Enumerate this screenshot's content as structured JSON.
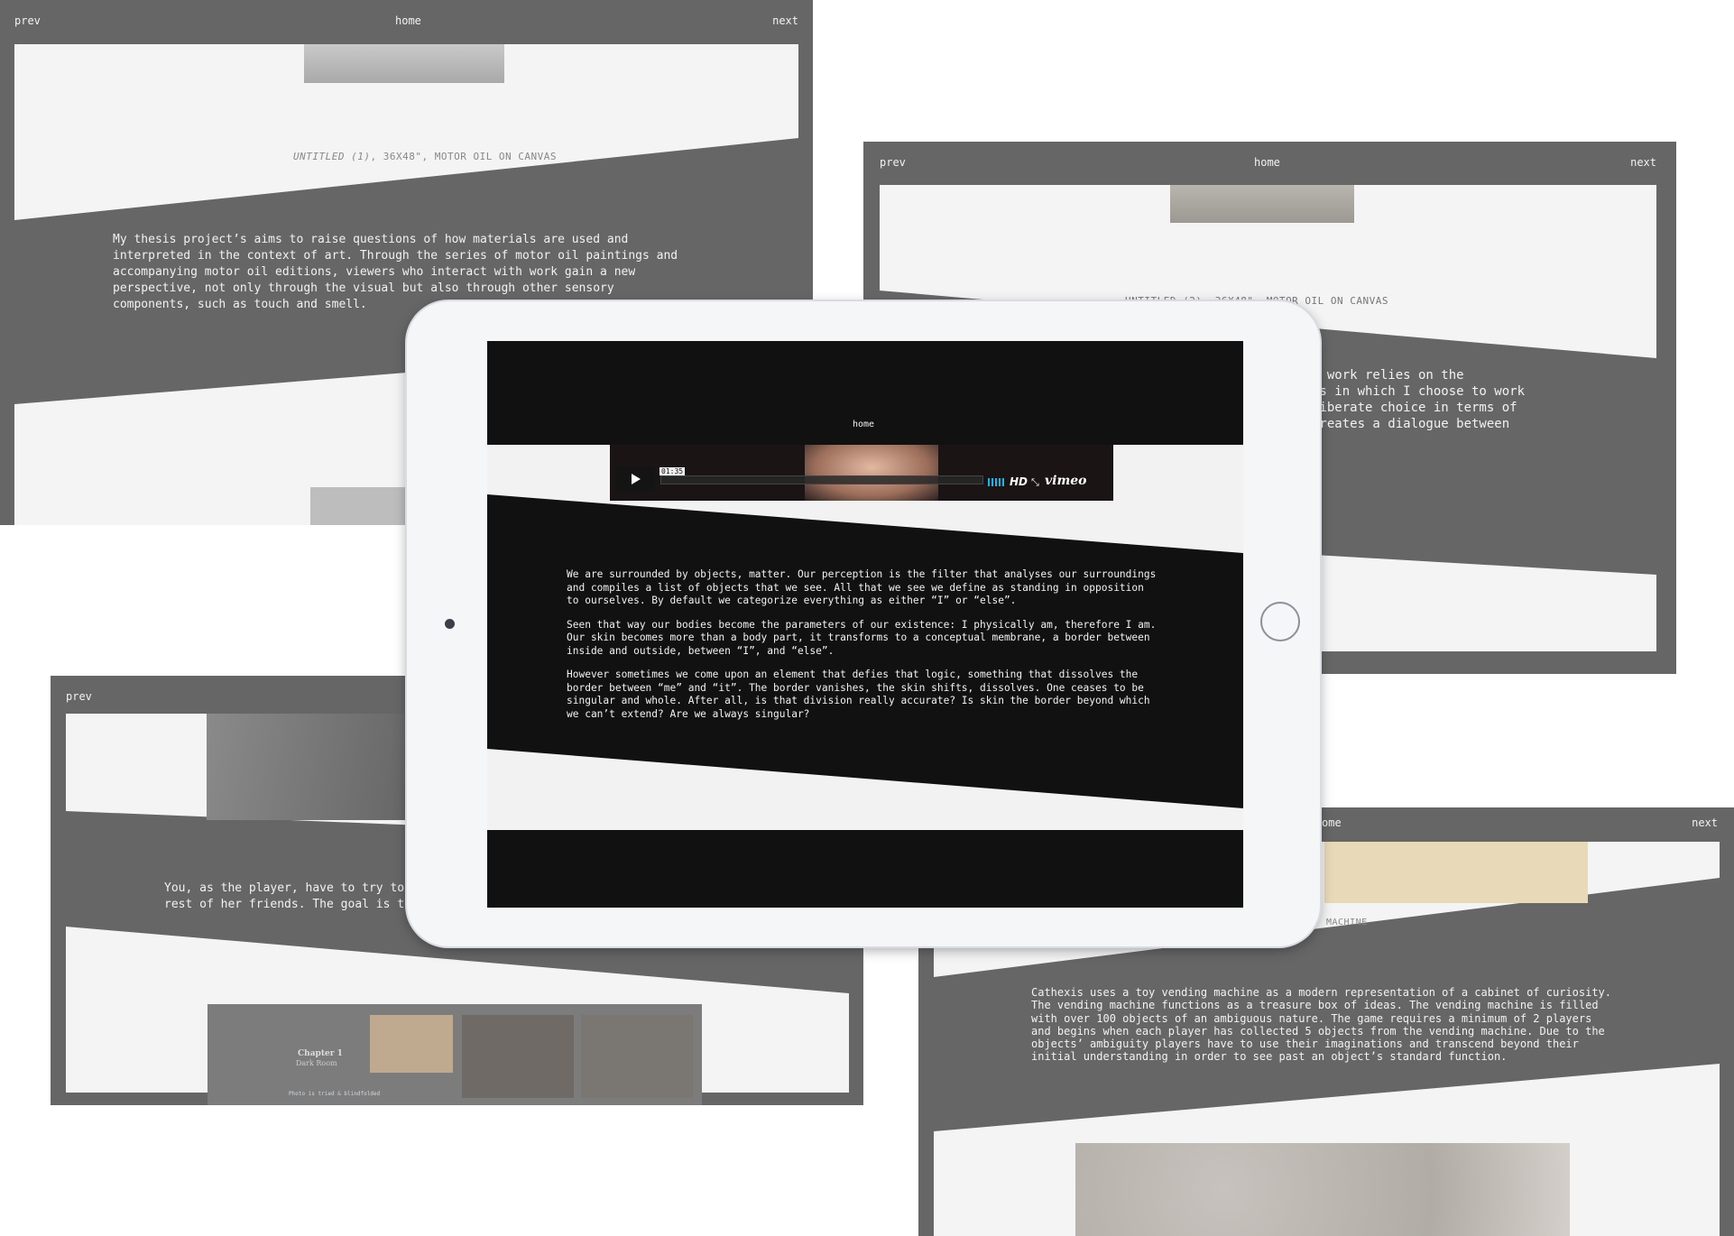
{
  "nav": {
    "prev": "prev",
    "home": "home",
    "next": "next"
  },
  "panel1": {
    "caption_italic": "UNTITLED (1)",
    "caption_rest": ", 36X48\", MOTOR OIL ON CANVAS",
    "text": "My thesis project’s aims to raise questions of how materials are used and interpreted in the context of art. Through the series of motor oil paintings and accompanying motor oil editions, viewers who interact with work gain a new perspective, not only through the visual but also through other sensory components, such as touch and smell."
  },
  "panel2": {
    "caption": "UNTITLED (2), 36X48\", MOTOR OIL ON CANVAS",
    "lines": [
      "f work relies on the",
      "ls in which I choose to work",
      "liberate choice in terms of",
      "creates a dialogue between"
    ]
  },
  "panel3": {
    "lines": [
      "You, as the player, have to try to help",
      "rest of her friends. The goal is to esca"
    ],
    "chapter_title": "Chapter 1",
    "chapter_sub": "Dark Room",
    "strip_note": "Photo is tried & blindfolded"
  },
  "panel4": {
    "home_partial": "ome",
    "caption_partial": "MACHINE",
    "text": "Cathexis uses a toy vending machine as a modern representation of a cabinet of curiosity. The vending machine functions as a treasure box of ideas. The vending machine is filled with over 100 objects of an ambiguous nature. The game requires a minimum of 2 players and begins when each player has collected 5 objects from the vending machine. Due to the objects’ ambiguity players have to use their imaginations and transcend beyond their initial understanding in order to see past an object’s standard function."
  },
  "ipad": {
    "home": "home",
    "video": {
      "time": "01:35",
      "hd": "HD",
      "brand": "vimeo"
    },
    "paragraphs": [
      "We are surrounded by objects, matter. Our perception is the filter that analyses our surroundings and compiles a list of objects that we see. All that we see we define as standing in opposition to ourselves. By default we categorize everything as either “I” or “else”.",
      "Seen that way our bodies become the parameters of our existence: I physically am, therefore I am. Our skin becomes more than a body part, it transforms to a conceptual membrane, a border between inside and outside, between “I”, and “else”.",
      "However sometimes we come upon an element that defies that logic, something that dissolves the border between “me” and “it”. The border vanishes, the skin shifts, dissolves. One ceases to be singular and whole. After all, is that division really accurate? Is skin the border beyond which we can’t extend? Are we always singular?"
    ]
  },
  "colors": {
    "panel": "#666666",
    "sheet": "#f4f4f4",
    "screen": "#111111",
    "ipad_frame": "#f5f6f8"
  }
}
